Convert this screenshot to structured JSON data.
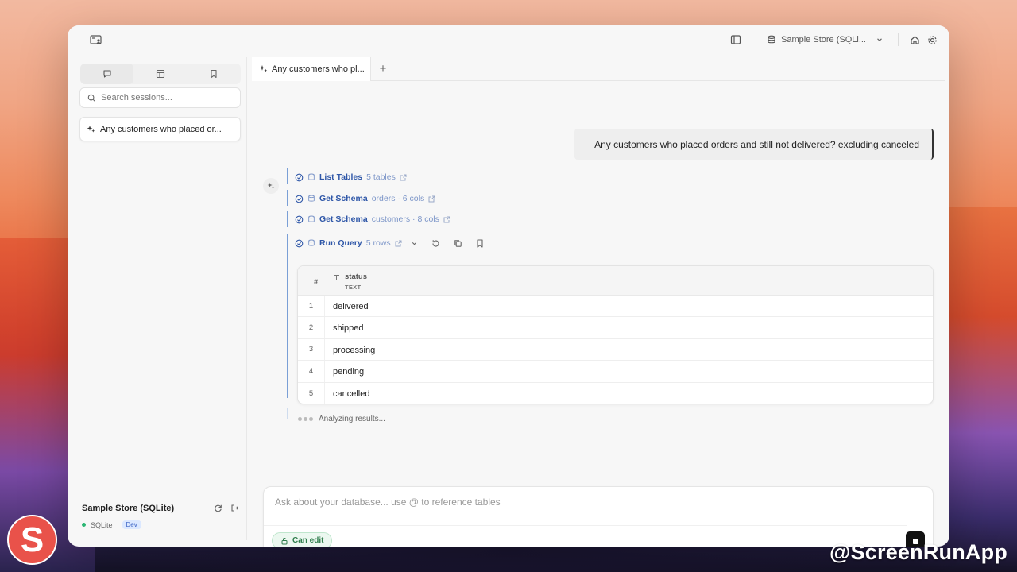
{
  "titlebar": {
    "database_select": "Sample Store (SQLi..."
  },
  "sidebar": {
    "search_placeholder": "Search sessions...",
    "sessions": [
      {
        "title": "Any customers who placed or..."
      }
    ],
    "footer": {
      "db_name": "Sample Store (SQLite)",
      "engine": "SQLite",
      "env_badge": "Dev"
    }
  },
  "main": {
    "tabs": [
      {
        "label": "Any customers who pl..."
      }
    ],
    "tab_add_label": "+",
    "user_message": "Any customers who placed orders and still not delivered? excluding canceled",
    "steps": [
      {
        "title": "List Tables",
        "detail": "5 tables"
      },
      {
        "title": "Get Schema",
        "detail": "orders · 6 cols"
      },
      {
        "title": "Get Schema",
        "detail": "customers · 8 cols"
      },
      {
        "title": "Run Query",
        "detail": "5 rows"
      }
    ],
    "result_table": {
      "index_header": "#",
      "column": {
        "name": "status",
        "type": "TEXT"
      },
      "rows": [
        {
          "index": "1",
          "status": "delivered"
        },
        {
          "index": "2",
          "status": "shipped"
        },
        {
          "index": "3",
          "status": "processing"
        },
        {
          "index": "4",
          "status": "pending"
        },
        {
          "index": "5",
          "status": "cancelled"
        }
      ]
    },
    "analyzing_text": "Analyzing results..."
  },
  "composer": {
    "placeholder": "Ask about your database... use @ to reference tables",
    "permission_label": "Can edit"
  },
  "overlay": {
    "logo_letter": "S",
    "watermark": "@ScreenRunApp"
  },
  "colors": {
    "step_title": "#2f57a8",
    "step_detail": "#7e97c9",
    "status_green": "#2bb673",
    "dev_badge_bg": "#dbe8ff",
    "can_edit_bg": "#ecf8f0",
    "logo_red": "#e9524a"
  }
}
